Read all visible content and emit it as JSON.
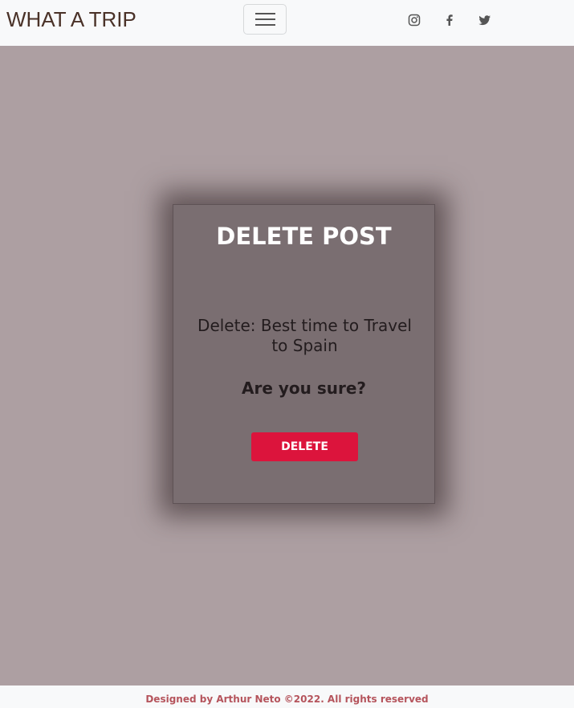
{
  "navbar": {
    "brand": "WHAT A TRIP",
    "toggler_icon": "hamburger-icon",
    "social": [
      {
        "name": "instagram-icon"
      },
      {
        "name": "facebook-icon"
      },
      {
        "name": "twitter-icon"
      }
    ]
  },
  "card": {
    "title": "DELETE POST",
    "delete_text": "Delete: Best time to Travel to Spain",
    "confirm_text": "Are you sure?",
    "delete_button": "DELETE"
  },
  "footer": {
    "text": "Designed by Arthur Neto ©2022. All rights reserved"
  },
  "colors": {
    "background": "#ad9fa2",
    "card": "#7a6e71",
    "delete_button": "#dc143c",
    "brand": "#4a3228",
    "footer_text": "#b5545c"
  }
}
